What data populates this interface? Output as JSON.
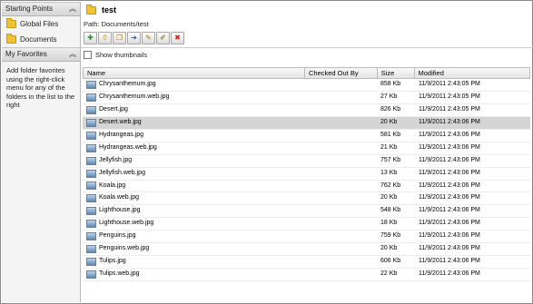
{
  "sidebar": {
    "starting_points": {
      "title": "Starting Points",
      "items": [
        {
          "label": "Global Files",
          "icon": "folder-icon"
        },
        {
          "label": "Documents",
          "icon": "folder-icon"
        }
      ]
    },
    "favorites": {
      "title": "My Favorites",
      "help_text": "Add folder favorites using the right-click menu for any of the folders in the list to the right"
    }
  },
  "header": {
    "folder_title": "test",
    "path_label": "Path: Documents/test"
  },
  "toolbar": {
    "buttons": [
      {
        "icon": "new-folder-icon",
        "glyph": "✚",
        "color": "#2e8b2e"
      },
      {
        "icon": "upload-icon",
        "glyph": "⇧",
        "color": "#b07a00"
      },
      {
        "icon": "copy-icon",
        "glyph": "❐",
        "color": "#b07a00"
      },
      {
        "icon": "move-icon",
        "glyph": "➜",
        "color": "#2e5fa8"
      },
      {
        "icon": "rename-icon",
        "glyph": "✎",
        "color": "#b07a00"
      },
      {
        "icon": "edit-icon",
        "glyph": "✐",
        "color": "#7a5c00"
      },
      {
        "icon": "delete-icon",
        "glyph": "✖",
        "color": "#d0201c"
      }
    ]
  },
  "options": {
    "show_thumbnails_label": "Show thumbnails",
    "show_thumbnails_checked": false
  },
  "grid": {
    "columns": [
      "Name",
      "Checked Out By",
      "Size",
      "Modified"
    ],
    "selected_index": 3,
    "rows": [
      {
        "name": "Chrysanthemum.jpg",
        "checked_out_by": "",
        "size": "858 Kb",
        "modified": "11/9/2011 2:43:05 PM"
      },
      {
        "name": "Chrysanthemum.web.jpg",
        "checked_out_by": "",
        "size": "27 Kb",
        "modified": "11/9/2011 2:43:05 PM"
      },
      {
        "name": "Desert.jpg",
        "checked_out_by": "",
        "size": "826 Kb",
        "modified": "11/9/2011 2:43:05 PM"
      },
      {
        "name": "Desert.web.jpg",
        "checked_out_by": "",
        "size": "20 Kb",
        "modified": "11/9/2011 2:43:06 PM"
      },
      {
        "name": "Hydrangeas.jpg",
        "checked_out_by": "",
        "size": "581 Kb",
        "modified": "11/9/2011 2:43:06 PM"
      },
      {
        "name": "Hydrangeas.web.jpg",
        "checked_out_by": "",
        "size": "21 Kb",
        "modified": "11/9/2011 2:43:06 PM"
      },
      {
        "name": "Jellyfish.jpg",
        "checked_out_by": "",
        "size": "757 Kb",
        "modified": "11/9/2011 2:43:06 PM"
      },
      {
        "name": "Jellyfish.web.jpg",
        "checked_out_by": "",
        "size": "13 Kb",
        "modified": "11/9/2011 2:43:06 PM"
      },
      {
        "name": "Koala.jpg",
        "checked_out_by": "",
        "size": "762 Kb",
        "modified": "11/9/2011 2:43:06 PM"
      },
      {
        "name": "Koala.web.jpg",
        "checked_out_by": "",
        "size": "20 Kb",
        "modified": "11/9/2011 2:43:06 PM"
      },
      {
        "name": "Lighthouse.jpg",
        "checked_out_by": "",
        "size": "548 Kb",
        "modified": "11/9/2011 2:43:06 PM"
      },
      {
        "name": "Lighthouse.web.jpg",
        "checked_out_by": "",
        "size": "18 Kb",
        "modified": "11/9/2011 2:43:06 PM"
      },
      {
        "name": "Penguins.jpg",
        "checked_out_by": "",
        "size": "759 Kb",
        "modified": "11/9/2011 2:43:06 PM"
      },
      {
        "name": "Penguins.web.jpg",
        "checked_out_by": "",
        "size": "20 Kb",
        "modified": "11/9/2011 2:43:06 PM"
      },
      {
        "name": "Tulips.jpg",
        "checked_out_by": "",
        "size": "606 Kb",
        "modified": "11/9/2011 2:43:06 PM"
      },
      {
        "name": "Tulips.web.jpg",
        "checked_out_by": "",
        "size": "22 Kb",
        "modified": "11/9/2011 2:43:06 PM"
      }
    ]
  },
  "colors": {
    "selected_row": "#d5d5d5",
    "folder_yellow": "#f1c232"
  }
}
